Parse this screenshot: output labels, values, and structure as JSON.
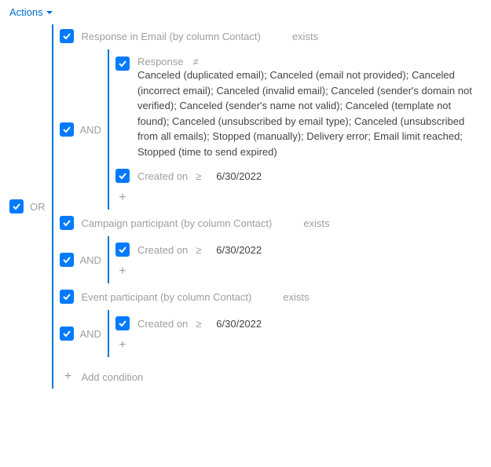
{
  "actions_label": "Actions",
  "root_op": "OR",
  "exists_label": "exists",
  "and_label": "AND",
  "plus_glyph": "+",
  "add_condition_label": "Add condition",
  "groups": [
    {
      "entity_label": "Response in Email (by column Contact)",
      "conditions": [
        {
          "field": "Response",
          "op": "≠",
          "value_long": "Canceled (duplicated email); Canceled (email not provided); Canceled (incorrect email); Canceled (invalid email); Canceled (sender's domain not verified); Canceled (sender's name not valid); Canceled (template not found); Canceled (unsubscribed by email type); Canceled (unsubscribed from all emails); Stopped (manually); Delivery error; Email limit reached; Stopped (time to send expired)"
        },
        {
          "field": "Created on",
          "op": "≥",
          "value": "6/30/2022"
        }
      ]
    },
    {
      "entity_label": "Campaign participant (by column Contact)",
      "conditions": [
        {
          "field": "Created on",
          "op": "≥",
          "value": "6/30/2022"
        }
      ]
    },
    {
      "entity_label": "Event participant (by column Contact)",
      "conditions": [
        {
          "field": "Created on",
          "op": "≥",
          "value": "6/30/2022"
        }
      ]
    }
  ]
}
